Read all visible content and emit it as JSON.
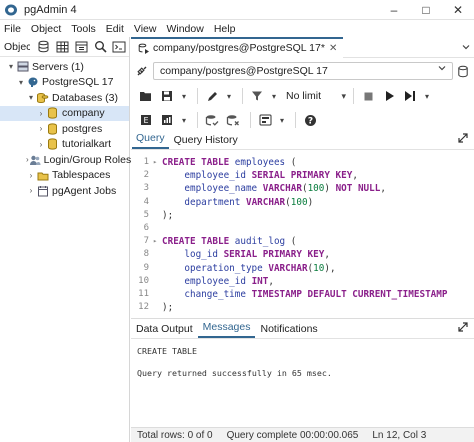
{
  "window": {
    "title": "pgAdmin 4",
    "min": "–",
    "max": "□",
    "close": "✕"
  },
  "menu": [
    "File",
    "Object",
    "Tools",
    "Edit",
    "View",
    "Window",
    "Help"
  ],
  "left_toolbar": {
    "label": "Objec"
  },
  "tree": [
    {
      "label": "Servers (1)",
      "chev": "▾",
      "icon": "servers-icon",
      "depth": 0
    },
    {
      "label": "PostgreSQL 17",
      "chev": "▾",
      "icon": "elephant-icon",
      "depth": 1
    },
    {
      "label": "Databases (3)",
      "chev": "▾",
      "icon": "databases-icon",
      "depth": 2
    },
    {
      "label": "company",
      "chev": "›",
      "icon": "database-icon",
      "depth": 3,
      "selected": true
    },
    {
      "label": "postgres",
      "chev": "›",
      "icon": "database-icon",
      "depth": 3
    },
    {
      "label": "tutorialkart",
      "chev": "›",
      "icon": "database-icon",
      "depth": 3
    },
    {
      "label": "Login/Group Roles",
      "chev": "›",
      "icon": "roles-icon",
      "depth": 2
    },
    {
      "label": "Tablespaces",
      "chev": "›",
      "icon": "tablespaces-icon",
      "depth": 2
    },
    {
      "label": "pgAgent Jobs",
      "chev": "›",
      "icon": "jobs-icon",
      "depth": 2
    }
  ],
  "doc_tab": {
    "label": "company/postgres@PostgreSQL 17*",
    "close": "✕"
  },
  "connection": {
    "value": "company/postgres@PostgreSQL 17"
  },
  "toolbar": {
    "limit": "No limit"
  },
  "query_tabs": [
    "Query",
    "Query History"
  ],
  "editor": {
    "line_numbers": [
      "1",
      "2",
      "3",
      "4",
      "5",
      "6",
      "7",
      "8",
      "9",
      "10",
      "11",
      "12"
    ]
  },
  "result_tabs": [
    "Data Output",
    "Messages",
    "Notifications"
  ],
  "messages": [
    "CREATE TABLE",
    "",
    "Query returned successfully in 65 msec."
  ],
  "status": {
    "rows": "Total rows: 0 of 0",
    "state": "Query complete 00:00:00.065",
    "position": "Ln 12, Col 3"
  },
  "colors": {
    "accent": "#326690",
    "keyword": "#8a1f8a",
    "identifier": "#2c3ea0",
    "number": "#0a7d3e"
  }
}
